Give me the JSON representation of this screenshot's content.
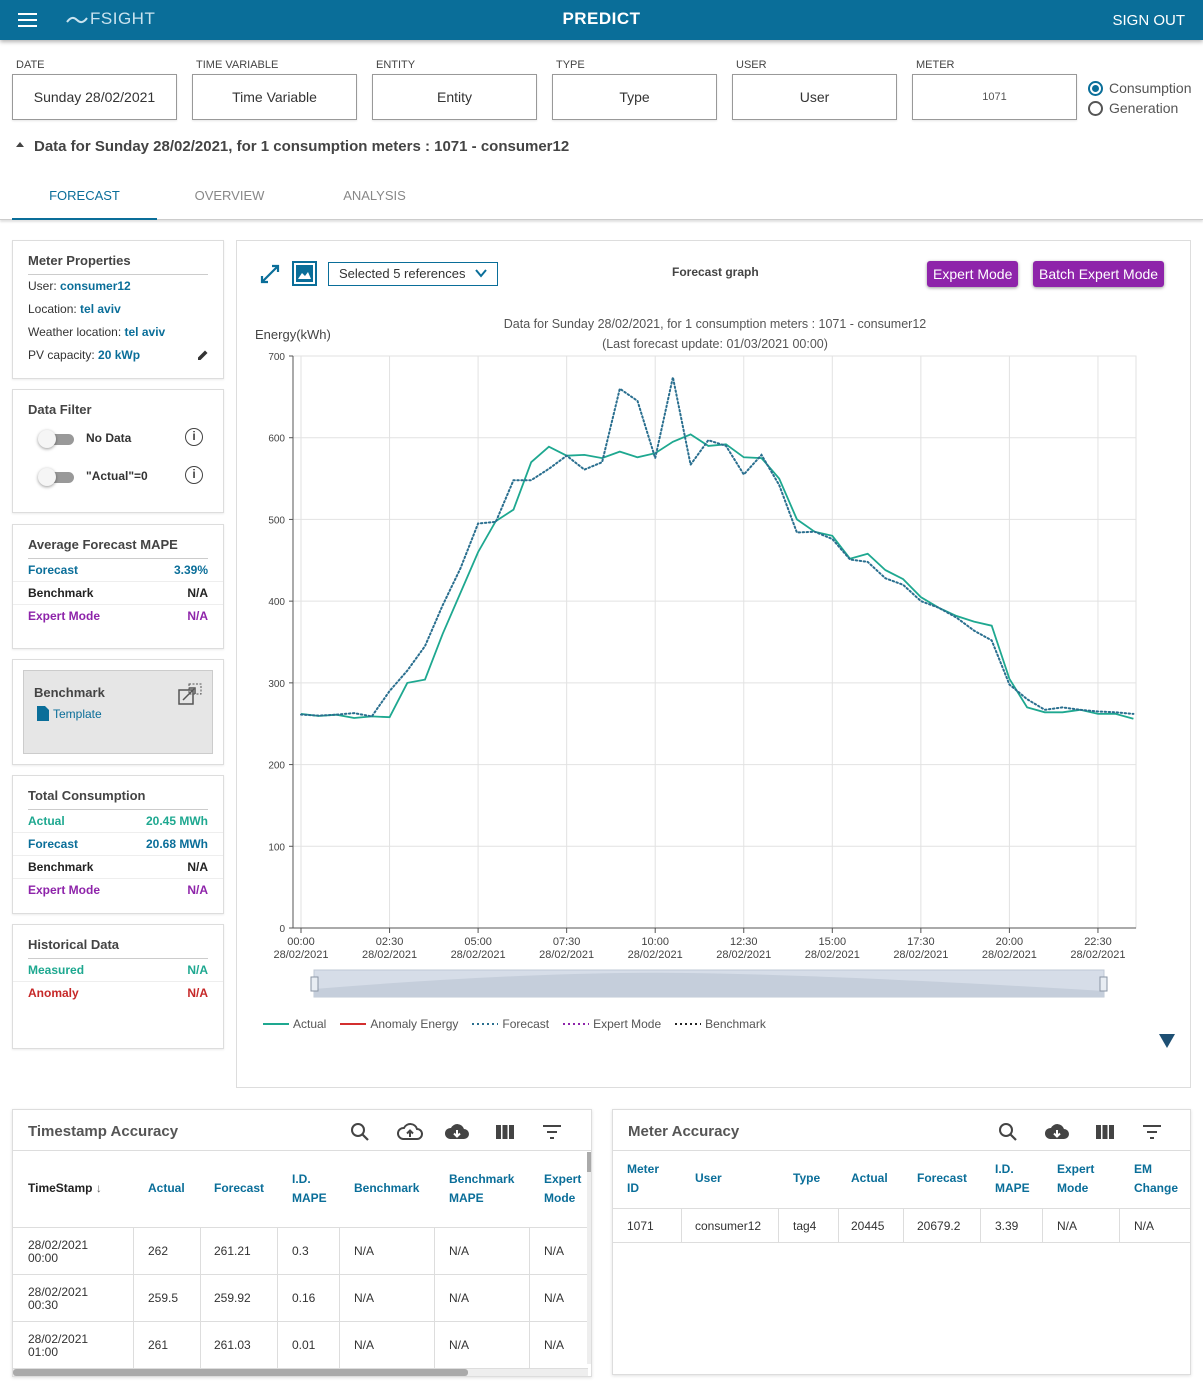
{
  "app": {
    "logo": "FSIGHT",
    "title": "PREDICT",
    "sign_out": "SIGN OUT"
  },
  "filters": [
    {
      "label": "DATE",
      "value": "Sunday 28/02/2021"
    },
    {
      "label": "TIME VARIABLE",
      "value": "Time Variable"
    },
    {
      "label": "ENTITY",
      "value": "Entity"
    },
    {
      "label": "TYPE",
      "value": "Type"
    },
    {
      "label": "USER",
      "value": "User"
    },
    {
      "label": "METER",
      "value": "1071"
    }
  ],
  "mode": {
    "consumption": "Consumption",
    "generation": "Generation",
    "selected": "Consumption"
  },
  "data_header": "Data for Sunday 28/02/2021, for 1 consumption meters : 1071 - consumer12",
  "tabs": [
    "FORECAST",
    "OVERVIEW",
    "ANALYSIS"
  ],
  "meter_properties": {
    "title": "Meter Properties",
    "user_label": "User:",
    "user": "consumer12",
    "location_label": "Location:",
    "location": "tel aviv",
    "weather_label": "Weather location:",
    "weather": "tel aviv",
    "pv_label": "PV capacity:",
    "pv": "20 kWp"
  },
  "data_filter": {
    "title": "Data Filter",
    "no_data": "No Data",
    "actual_zero": "\"Actual\"=0"
  },
  "mape": {
    "title": "Average Forecast MAPE",
    "forecast_label": "Forecast",
    "forecast": "3.39%",
    "benchmark_label": "Benchmark",
    "benchmark": "N/A",
    "expert_label": "Expert Mode",
    "expert": "N/A"
  },
  "benchmark_card": {
    "title": "Benchmark",
    "template": "Template"
  },
  "total": {
    "title": "Total Consumption",
    "actual_label": "Actual",
    "actual": "20.45 MWh",
    "forecast_label": "Forecast",
    "forecast": "20.68 MWh",
    "benchmark_label": "Benchmark",
    "benchmark": "N/A",
    "expert_label": "Expert Mode",
    "expert": "N/A"
  },
  "historical": {
    "title": "Historical Data",
    "measured_label": "Measured",
    "measured": "N/A",
    "anomaly_label": "Anomaly",
    "anomaly": "N/A"
  },
  "graph": {
    "references": "Selected 5 references",
    "title": "Forecast graph",
    "expert_btn": "Expert Mode",
    "batch_btn": "Batch Expert Mode"
  },
  "colors": {
    "primary": "#0a6e99",
    "actual": "#1ea890",
    "forecast": "#2a6f8f",
    "expert": "#8e24aa",
    "anomaly": "#d32f2f",
    "benchmark": "#222222"
  },
  "chart_data": {
    "type": "line",
    "title": "Data for Sunday 28/02/2021, for 1  consumption meters : 1071 - consumer12",
    "subtitle": "(Last forecast update: 01/03/2021 00:00)",
    "ylabel": "Energy(kWh)",
    "ylim": [
      0,
      700
    ],
    "yticks": [
      0,
      100,
      200,
      300,
      400,
      500,
      600,
      700
    ],
    "xlim": [
      0,
      23.5
    ],
    "xticks": [
      {
        "h": 0,
        "time": "00:00",
        "date": "28/02/2021"
      },
      {
        "h": 2.5,
        "time": "02:30",
        "date": "28/02/2021"
      },
      {
        "h": 5,
        "time": "05:00",
        "date": "28/02/2021"
      },
      {
        "h": 7.5,
        "time": "07:30",
        "date": "28/02/2021"
      },
      {
        "h": 10,
        "time": "10:00",
        "date": "28/02/2021"
      },
      {
        "h": 12.5,
        "time": "12:30",
        "date": "28/02/2021"
      },
      {
        "h": 15,
        "time": "15:00",
        "date": "28/02/2021"
      },
      {
        "h": 17.5,
        "time": "17:30",
        "date": "28/02/2021"
      },
      {
        "h": 20,
        "time": "20:00",
        "date": "28/02/2021"
      },
      {
        "h": 22.5,
        "time": "22:30",
        "date": "28/02/2021"
      }
    ],
    "x_hours": [
      0,
      0.5,
      1,
      1.5,
      2,
      2.5,
      3,
      3.5,
      4,
      4.5,
      5,
      5.5,
      6,
      6.5,
      7,
      7.5,
      8,
      8.5,
      9,
      9.5,
      10,
      10.5,
      11,
      11.5,
      12,
      12.5,
      13,
      13.5,
      14,
      14.5,
      15,
      15.5,
      16,
      16.5,
      17,
      17.5,
      18,
      18.5,
      19,
      19.5,
      20,
      20.5,
      21,
      21.5,
      22,
      22.5,
      23,
      23.5
    ],
    "series": [
      {
        "name": "Actual",
        "style": "solid",
        "values": [
          262,
          259.5,
          261,
          257,
          259,
          258,
          300,
          304,
          360,
          410,
          460,
          498,
          512,
          570,
          589,
          578,
          579,
          575,
          583,
          576,
          581,
          595,
          604,
          590,
          592,
          576,
          575,
          550,
          500,
          485,
          480,
          452,
          458,
          438,
          427,
          405,
          392,
          382,
          375,
          370,
          305,
          270,
          264,
          264,
          267,
          262,
          262,
          256
        ]
      },
      {
        "name": "Forecast",
        "style": "dotted",
        "values": [
          261.21,
          259.92,
          261.03,
          263,
          259,
          290,
          315,
          345,
          395,
          440,
          495,
          497,
          548,
          548,
          562,
          578,
          561,
          570,
          660,
          645,
          575,
          674,
          567,
          597,
          590,
          555,
          579,
          542,
          484,
          485,
          476,
          451,
          448,
          428,
          420,
          400,
          392,
          380,
          364,
          352,
          298,
          280,
          267,
          270,
          267,
          265,
          264,
          262
        ]
      }
    ],
    "legend": [
      "Actual",
      "Anomaly Energy",
      "Forecast",
      "Expert Mode",
      "Benchmark"
    ],
    "legend_position": "bottom"
  },
  "timestamp_table": {
    "title": "Timestamp Accuracy",
    "headers": [
      "TimeStamp",
      "Actual",
      "Forecast",
      "I.D. MAPE",
      "Benchmark",
      "Benchmark MAPE",
      "Expert Mode"
    ],
    "rows": [
      [
        "28/02/2021 00:00",
        "262",
        "261.21",
        "0.3",
        "N/A",
        "N/A",
        "N/A"
      ],
      [
        "28/02/2021 00:30",
        "259.5",
        "259.92",
        "0.16",
        "N/A",
        "N/A",
        "N/A"
      ],
      [
        "28/02/2021 01:00",
        "261",
        "261.03",
        "0.01",
        "N/A",
        "N/A",
        "N/A"
      ]
    ]
  },
  "meter_table": {
    "title": "Meter Accuracy",
    "headers": [
      "Meter ID",
      "User",
      "Type",
      "Actual",
      "Forecast",
      "I.D. MAPE",
      "Expert Mode",
      "EM Change"
    ],
    "rows": [
      [
        "1071",
        "consumer12",
        "tag4",
        "20445",
        "20679.2",
        "3.39",
        "N/A",
        "N/A"
      ]
    ]
  }
}
